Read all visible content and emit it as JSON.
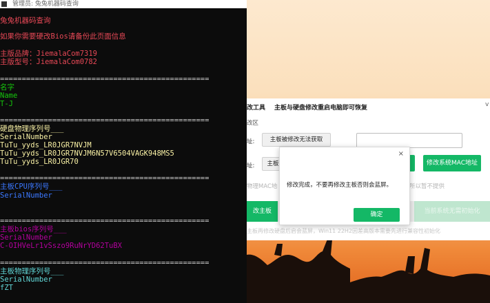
{
  "console": {
    "title": "管理员: 兔兔机器码查询",
    "lines": [
      {
        "text": "兔兔机器码查询",
        "color": "#e74856"
      },
      {
        "text": "如果你需要硬改Bios请备份此页面信息",
        "color": "#e74856"
      },
      {
        "text": "主版品牌：JiemalaCom7319",
        "color": "#e74856"
      },
      {
        "text": "主版型号：JiemalaCom0782",
        "color": "#e74856"
      },
      {
        "text": "================================================",
        "color": "#cccccc"
      },
      {
        "text": "名字",
        "color": "#16c60c"
      },
      {
        "text": "Name",
        "color": "#16c60c"
      },
      {
        "text": "T-J",
        "color": "#16c60c"
      },
      {
        "text": "================================================",
        "color": "#cccccc"
      },
      {
        "text": "硬盘物理序列号___",
        "color": "#f9f1a5"
      },
      {
        "text": "SerialNumber",
        "color": "#f9f1a5"
      },
      {
        "text": "TuTu_yyds_LR0JGR7NVJM",
        "color": "#f9f1a5"
      },
      {
        "text": "TuTu_yyds_LR0JGR7NVJM6N57V6504VAGK948MS5",
        "color": "#f9f1a5"
      },
      {
        "text": "TuTu_yyds_LR0JGR70",
        "color": "#f9f1a5"
      },
      {
        "text": "================================================",
        "color": "#cccccc"
      },
      {
        "text": "主板CPU序列号___",
        "color": "#3b78ff"
      },
      {
        "text": "SerialNumber",
        "color": "#3b78ff"
      },
      {
        "text": "================================================",
        "color": "#cccccc"
      },
      {
        "text": "主板bios序列号___",
        "color": "#b4009e"
      },
      {
        "text": "SerialNumber",
        "color": "#b4009e"
      },
      {
        "text": "C-OIHVeLr1vSszo9RuNrYD62TuBX",
        "color": "#b4009e"
      },
      {
        "text": "================================================",
        "color": "#cccccc"
      },
      {
        "text": "主板物理序列号___",
        "color": "#61d6d6"
      },
      {
        "text": "SerialNumber",
        "color": "#61d6d6"
      },
      {
        "text": "fZT",
        "color": "#61d6d6"
      }
    ]
  },
  "tool": {
    "title": "改工具",
    "subtitle": "主板与硬盘修改重启电脑即可恢复",
    "chevron": "v",
    "section": "改区",
    "row1_label": "址:",
    "row1_button": "主板被修改无法获取",
    "row2_label": "址:",
    "row2_button": "主板",
    "mac_button": "修改系统MAC地址",
    "hint_left": "物理MAC地",
    "hint_right": "所以暂不提供",
    "band_left": "改主板",
    "band_right": "当前系统无需初始化",
    "footer": "主板再修改硬盘后启会蓝屏，Win11 22H2因差高版本需要先进行兼容性初始化"
  },
  "dialog": {
    "close": "×",
    "message": "修改完成，不要再修改主板否则会蓝屏。",
    "ok": "确定"
  },
  "colors": {
    "accent": "#14b866",
    "console_bg": "#0c0c0c"
  }
}
